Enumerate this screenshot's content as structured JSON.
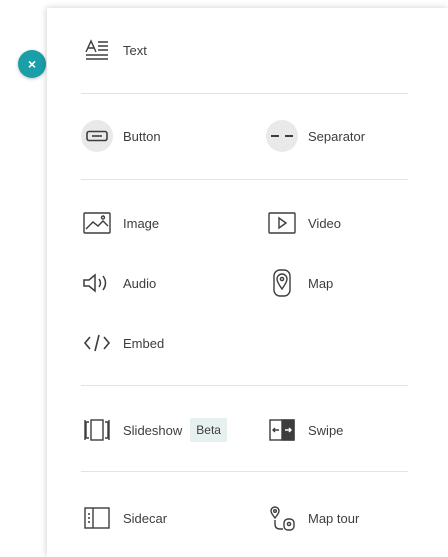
{
  "close_button": {
    "symbol": "×"
  },
  "panel": {
    "items": {
      "text": {
        "label": "Text",
        "icon": "text-icon"
      },
      "button": {
        "label": "Button",
        "icon": "button-icon"
      },
      "separator": {
        "label": "Separator",
        "icon": "separator-icon"
      },
      "image": {
        "label": "Image",
        "icon": "image-icon"
      },
      "video": {
        "label": "Video",
        "icon": "video-icon"
      },
      "audio": {
        "label": "Audio",
        "icon": "audio-icon"
      },
      "map": {
        "label": "Map",
        "icon": "map-icon"
      },
      "embed": {
        "label": "Embed",
        "icon": "embed-icon"
      },
      "slideshow": {
        "label": "Slideshow",
        "icon": "slideshow-icon",
        "badge": "Beta"
      },
      "swipe": {
        "label": "Swipe",
        "icon": "swipe-icon"
      },
      "sidecar": {
        "label": "Sidecar",
        "icon": "sidecar-icon"
      },
      "map_tour": {
        "label": "Map tour",
        "icon": "map-tour-icon"
      }
    }
  },
  "colors": {
    "accent": "#1a9ea8",
    "text": "#3d3d3d",
    "divider": "#e3e3e3",
    "badge_bg": "#e6f0ef"
  }
}
